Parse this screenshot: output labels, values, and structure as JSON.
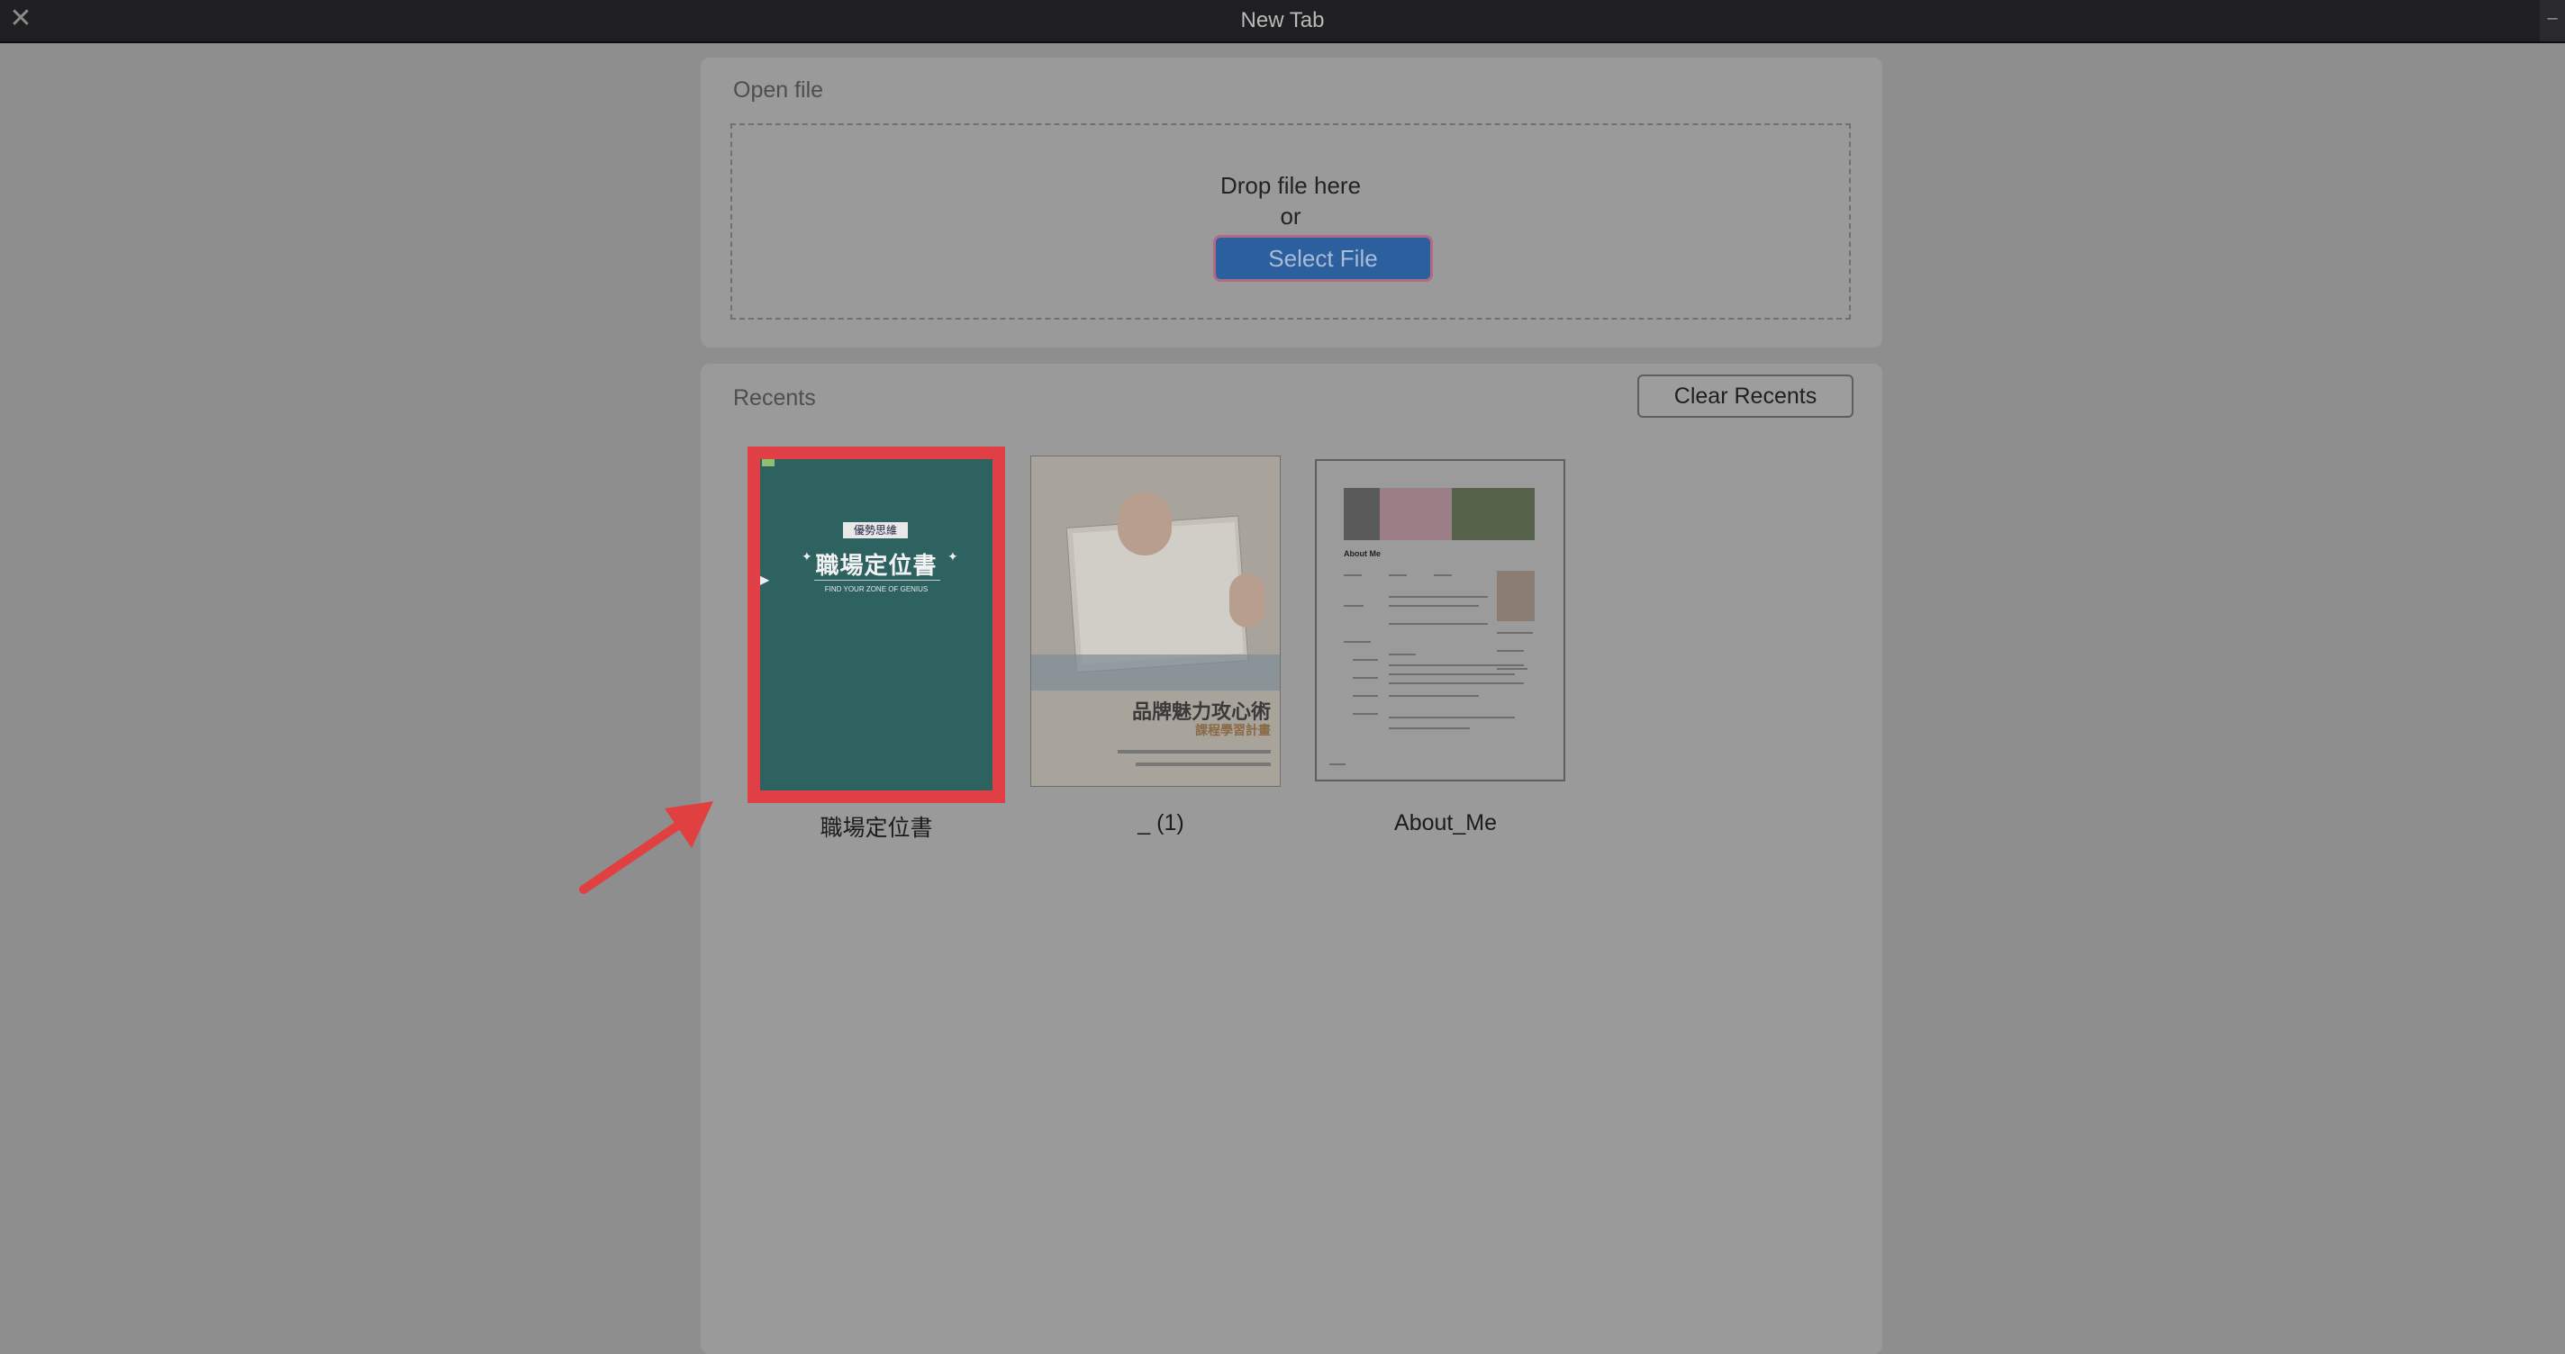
{
  "window": {
    "title": "New Tab",
    "close_glyph": "✕",
    "corner_glyph": "–"
  },
  "open_file": {
    "label": "Open file",
    "drop_text": "Drop file here",
    "or_text": "or",
    "select_button": "Select File"
  },
  "recents": {
    "label": "Recents",
    "clear_button": "Clear Recents",
    "items": [
      {
        "label": "職場定位書",
        "cover_badge": "優勢思維",
        "cover_title": "職場定位書",
        "cover_subtitle": "FIND YOUR ZONE OF GENIUS"
      },
      {
        "label": "_ (1)",
        "cover_title": "品牌魅力攻心術",
        "cover_subtitle": "課程學習計畫"
      },
      {
        "label": "About_Me",
        "cover_title": "About Me"
      }
    ]
  },
  "colors": {
    "highlight_border": "#e04045",
    "annotation_arrow": "#e0403f",
    "select_button_bg": "#2c5f9e",
    "cover1_bg": "#2e6261"
  },
  "icons": {
    "close": "close-icon",
    "annotation": "arrow-annotation-icon"
  }
}
